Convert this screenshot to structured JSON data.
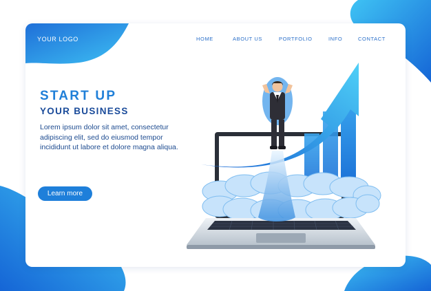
{
  "brand": {
    "logo_text": "YOUR LOGO"
  },
  "nav": {
    "items": [
      {
        "label": "HOME"
      },
      {
        "label": "ABOUT US"
      },
      {
        "label": "PORTFOLIO"
      },
      {
        "label": "INFO"
      },
      {
        "label": "CONTACT"
      }
    ]
  },
  "hero": {
    "headline": "START UP",
    "subheadline": "YOUR BUSINESS",
    "body": "Lorem ipsum dolor sit amet, consectetur adipiscing elit, sed do eiusmod tempor incididunt ut labore et dolore magna aliqua.",
    "button_label": "Learn more"
  },
  "colors": {
    "primary_blue": "#1e7fda",
    "dark_blue": "#1a4b9a",
    "light_blue": "#5ec8f5",
    "background": "#ffffff"
  },
  "icons": [
    "rocket-businessman",
    "growth-arrow",
    "laptop",
    "clouds"
  ]
}
